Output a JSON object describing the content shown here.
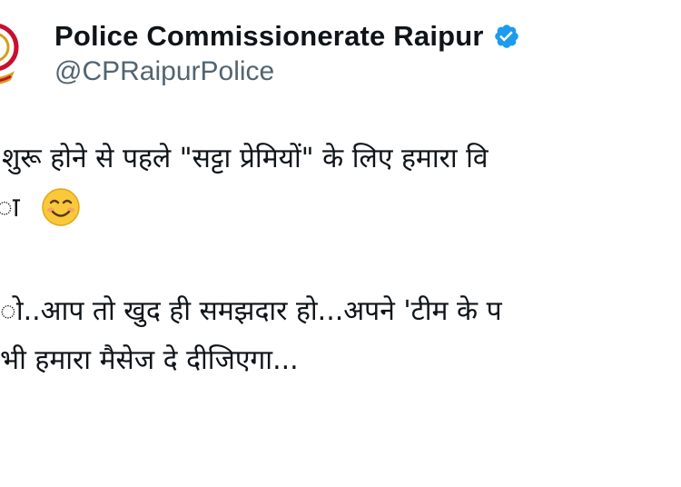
{
  "account": {
    "display_name": "Police Commissionerate Raipur",
    "handle": "@CPRaipurPolice",
    "verified": true,
    "avatar_icon": "police-emblem-icon",
    "verified_icon": "verified-badge-icon"
  },
  "tweet": {
    "line1": "शुरू होने से पहले \"सट्टा प्रेमियों\" के लिए हमारा वि",
    "line2": "ा",
    "line2_emoji": "smiling-face-emoji-icon",
    "line3": "ो..आप तो खुद ही समझदार हो...अपने 'टीम के प",
    "line4": "भी  हमारा मैसेज दे दीजिएगा..."
  },
  "colors": {
    "name": "#0f1419",
    "handle": "#536471",
    "verified_blue": "#1d9bf0",
    "emblem_red": "#c8102e",
    "emblem_gold": "#d4a017"
  }
}
